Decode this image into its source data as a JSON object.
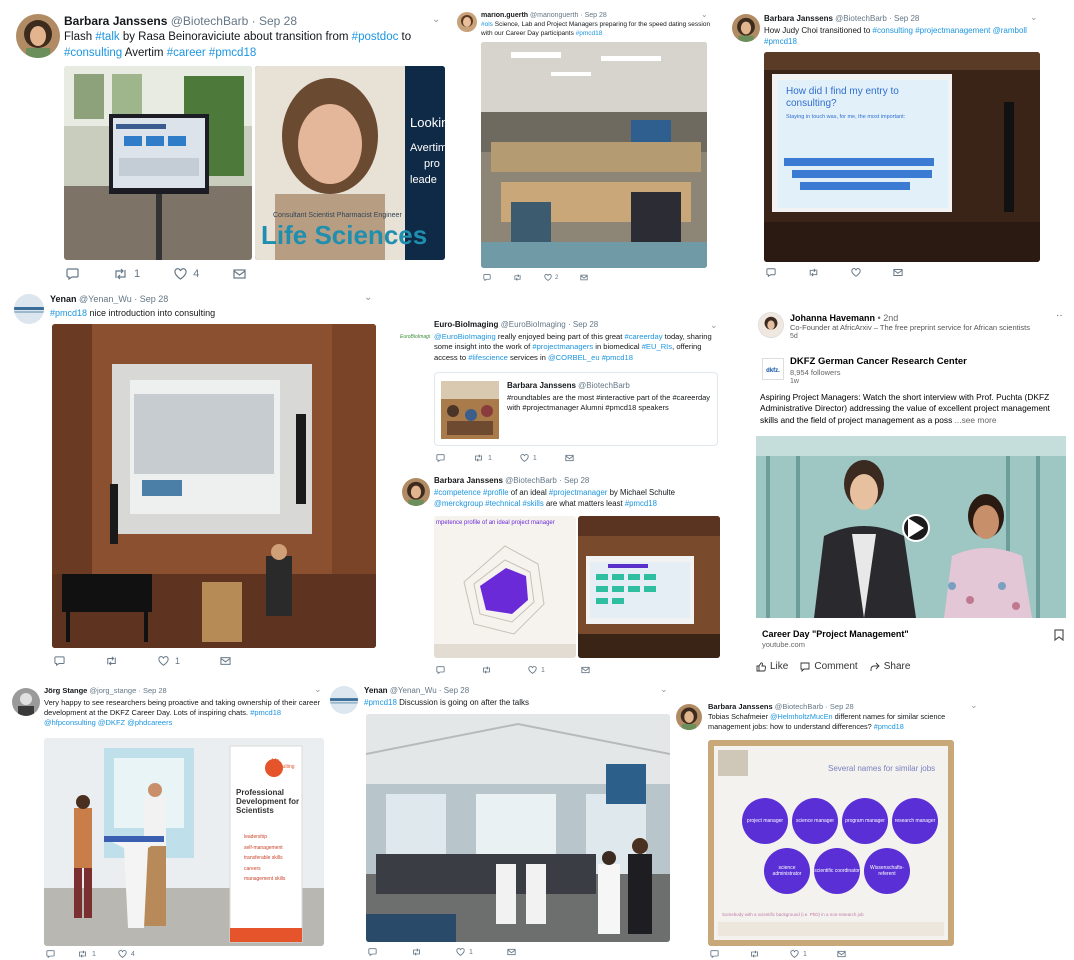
{
  "t1": {
    "name": "Barbara Janssens",
    "handle": "@BiotechBarb",
    "date": "Sep 28",
    "text": [
      {
        "t": "Flash "
      },
      {
        "t": "#talk",
        "tag": true
      },
      {
        "t": " by Rasa Beinoraviciute about transition from "
      },
      {
        "t": "#postdoc",
        "tag": true
      },
      {
        "t": " to "
      },
      {
        "t": "#consulting",
        "tag": true
      },
      {
        "t": " Avertim  "
      },
      {
        "t": "#career",
        "tag": true
      },
      {
        "t": " "
      },
      {
        "t": "#pmcd18",
        "tag": true
      }
    ],
    "poster_word1": "Life Sciences",
    "poster_words_small": "Consultant Scientist Pharmacist Engineer",
    "poster_right": [
      "Looking",
      "Avertim",
      "pro",
      "leade"
    ],
    "retweets": "1",
    "likes": "4"
  },
  "t2": {
    "name": "marion.guerth",
    "handle": "@marionguerth",
    "date": "Sep 28",
    "text": [
      {
        "t": "#ols",
        "tag": true
      },
      {
        "t": " Science, Lab and Project Managers preparing for the speed dating session with our Career Day participants "
      },
      {
        "t": "#pmcd18",
        "tag": true
      }
    ],
    "likes": "2"
  },
  "t3": {
    "name": "Barbara Janssens",
    "handle": "@BiotechBarb",
    "date": "Sep 28",
    "text": [
      {
        "t": "How Judy Choi transitioned to "
      },
      {
        "t": "#consulting",
        "tag": true
      },
      {
        "t": " "
      },
      {
        "t": "#projectmanagement",
        "tag": true
      },
      {
        "t": " "
      },
      {
        "t": "@ramboll",
        "tag": true
      },
      {
        "t": " "
      },
      {
        "t": "#pmcd18",
        "tag": true
      }
    ],
    "slide_title": "How did I find my entry to consulting?",
    "slide_sub": "Staying in touch was, for me, the most important:"
  },
  "t4": {
    "name": "Yenan",
    "handle": "@Yenan_Wu",
    "date": "Sep 28",
    "text": [
      {
        "t": "#pmcd18",
        "tag": true
      },
      {
        "t": " nice introduction into consulting"
      }
    ],
    "likes": "1"
  },
  "t5": {
    "name": "Euro-BioImaging",
    "handle": "@EuroBioImaging",
    "date": "Sep 28",
    "logo_text": "EuroBioImaging",
    "text": [
      {
        "t": "@EuroBioImaging",
        "tag": true
      },
      {
        "t": " really enjoyed being part of this great "
      },
      {
        "t": "#careerday",
        "tag": true
      },
      {
        "t": " today, sharing some insight into the work of "
      },
      {
        "t": "#projectmanagers",
        "tag": true
      },
      {
        "t": " in biomedical "
      },
      {
        "t": "#EU_RIs",
        "tag": true
      },
      {
        "t": ", offering access to "
      },
      {
        "t": "#lifescience",
        "tag": true
      },
      {
        "t": " services in "
      },
      {
        "t": "@CORBEL_eu",
        "tag": true
      },
      {
        "t": " "
      },
      {
        "t": "#pmcd18",
        "tag": true
      }
    ],
    "quote": {
      "name": "Barbara Janssens",
      "handle": "@BiotechBarb",
      "text": "#roundtables are the most #interactive part of the #careerday with #projectmanager Alumni #pmcd18 speakers"
    },
    "retweets": "1",
    "likes": "1"
  },
  "t6": {
    "name": "Barbara Janssens",
    "handle": "@BiotechBarb",
    "date": "Sep 28",
    "text": [
      {
        "t": "#competence",
        "tag": true
      },
      {
        "t": " "
      },
      {
        "t": "#profile",
        "tag": true
      },
      {
        "t": " of an ideal "
      },
      {
        "t": "#projectmanager",
        "tag": true
      },
      {
        "t": " by Michael Schulte "
      },
      {
        "t": "@merckgroup",
        "tag": true
      },
      {
        "t": " "
      },
      {
        "t": "#technical",
        "tag": true
      },
      {
        "t": " "
      },
      {
        "t": "#skills",
        "tag": true
      },
      {
        "t": " are what matters least "
      },
      {
        "t": "#pmcd18",
        "tag": true
      }
    ],
    "chart_title": "mpetence profile of an ideal project manager",
    "likes": "1"
  },
  "t7": {
    "name": "Johanna Havemann",
    "degree": "• 2nd",
    "headline": "Co-Founder at AfricArxiv – The free preprint service for African scientists",
    "ago": "5d",
    "org_name": "DKFZ German Cancer Research Center",
    "org_logo": "dkfz.",
    "followers": "8,954 followers",
    "org_ago": "1w",
    "post": "Aspiring Project Managers: Watch the short interview with Prof. Puchta (DKFZ Administrative Director) addressing the value of excellent project management skills and the field of project management as a poss",
    "see_more": "...see more",
    "video_title": "Career Day \"Project Management\"",
    "video_source": "youtube.com",
    "like": "Like",
    "comment": "Comment",
    "share": "Share"
  },
  "t8": {
    "name": "Jörg Stange",
    "handle": "@jorg_stange",
    "date": "Sep 28",
    "text": [
      {
        "t": "Very happy to see researchers being proactive and taking ownership of their career development at the DKFZ Career Day. Lots of inspiring chats. "
      },
      {
        "t": "#pmcd18",
        "tag": true
      },
      {
        "t": " "
      },
      {
        "t": "@hfpconsulting",
        "tag": true
      },
      {
        "t": " "
      },
      {
        "t": "@DKFZ",
        "tag": true
      },
      {
        "t": " "
      },
      {
        "t": "@phdcareers",
        "tag": true
      }
    ],
    "banner_brand": "hfp consulting",
    "banner_title": "Professional Development for Scientists",
    "banner_items": [
      "leadership",
      "self-management",
      "transferable skills",
      "careers",
      "management skills"
    ],
    "retweets": "1",
    "likes": "4"
  },
  "t9": {
    "name": "Yenan",
    "handle": "@Yenan_Wu",
    "date": "Sep 28",
    "text": [
      {
        "t": "#pmcd18",
        "tag": true
      },
      {
        "t": " Discussion is going on after the talks"
      }
    ],
    "likes": "1"
  },
  "t10": {
    "name": "Barbara Janssens",
    "handle": "@BiotechBarb",
    "date": "Sep 28",
    "text": [
      {
        "t": "Tobias Schafmeier "
      },
      {
        "t": "@HelmholtzMucEn",
        "tag": true
      },
      {
        "t": " different names for similar science management jobs: how to understand differences? "
      },
      {
        "t": "#pmcd18",
        "tag": true
      }
    ],
    "slide_title": "Several names for similar jobs",
    "bubbles": [
      "project manager",
      "science manager",
      "program manager",
      "research manager",
      "science administrator",
      "scientific coordinator",
      "Wissenschafts-referent"
    ],
    "slide_footer": "Somebody with a scientific background (i.e. PhD) in a non-research job",
    "likes": "1"
  },
  "colors": {
    "twitter_blue": "#1b95e0",
    "gray": "#657786",
    "slide_purple": "#5a2fd6",
    "linkedin_blue": "#0a66c2"
  }
}
